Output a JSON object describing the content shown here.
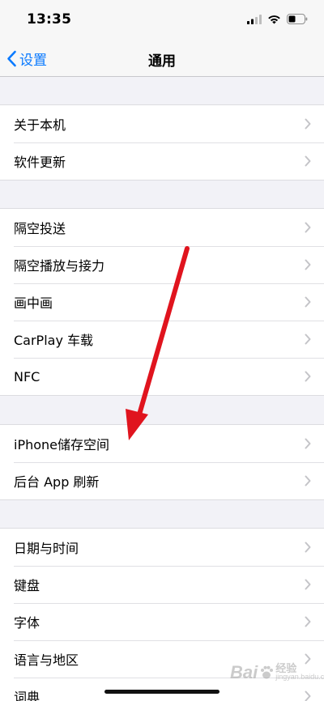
{
  "status_bar": {
    "time": "13:35",
    "icons": [
      "signal-icon",
      "wifi-icon",
      "battery-icon"
    ]
  },
  "nav": {
    "back_label": "设置",
    "title": "通用"
  },
  "groups": [
    {
      "items": [
        {
          "label": "关于本机"
        },
        {
          "label": "软件更新"
        }
      ]
    },
    {
      "items": [
        {
          "label": "隔空投送"
        },
        {
          "label": "隔空播放与接力"
        },
        {
          "label": "画中画"
        },
        {
          "label": "CarPlay 车载"
        },
        {
          "label": "NFC"
        }
      ]
    },
    {
      "items": [
        {
          "label": "iPhone储存空间"
        },
        {
          "label": "后台 App 刷新"
        }
      ]
    },
    {
      "items": [
        {
          "label": "日期与时间"
        },
        {
          "label": "键盘"
        },
        {
          "label": "字体"
        },
        {
          "label": "语言与地区"
        },
        {
          "label": "词典"
        }
      ]
    }
  ],
  "annotation": {
    "color": "#e0141e"
  },
  "colors": {
    "accent": "#0a7aff",
    "background": "#f2f2f7",
    "chevron": "#c4c4c8"
  },
  "watermark": {
    "logo": "Bai",
    "text_top": "经验",
    "text_bottom": "jingyan.baidu.com"
  }
}
